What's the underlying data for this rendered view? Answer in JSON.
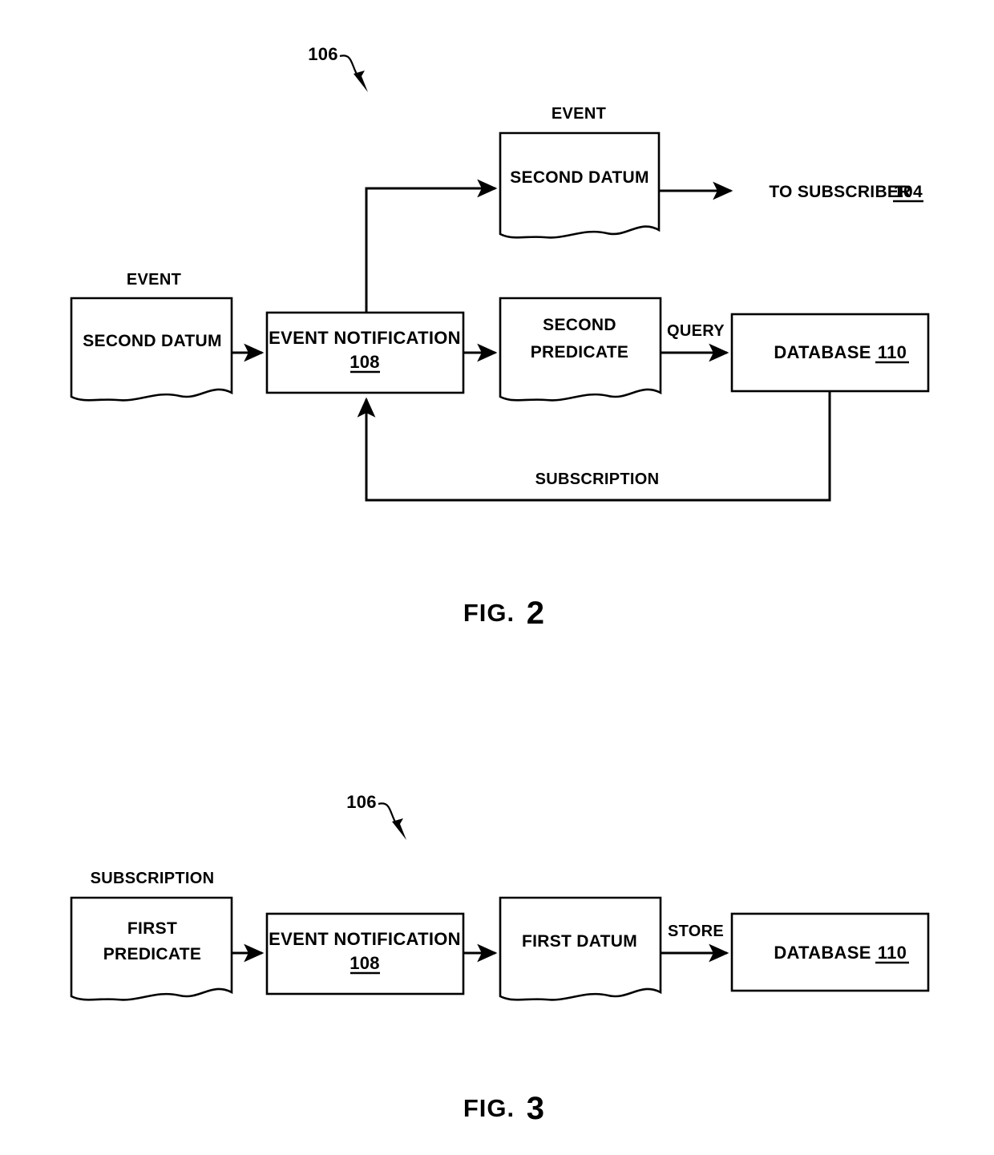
{
  "sheet": {
    "background": "#ffffff",
    "ink": "#000000"
  },
  "figures": [
    {
      "id": "fig2",
      "caption_prefix": "FIG.",
      "caption_number": "2",
      "reference_numeral": "106",
      "nodes": [
        {
          "name": "event-second-datum-top",
          "shape": "document",
          "caption_above": "EVENT",
          "lines": [
            "SECOND DATUM"
          ]
        },
        {
          "name": "event-second-datum-left",
          "shape": "document",
          "caption_above": "EVENT",
          "lines": [
            "SECOND DATUM"
          ]
        },
        {
          "name": "event-notification",
          "shape": "rectangle",
          "lines": [
            "EVENT NOTIFICATION"
          ],
          "numeral": "108"
        },
        {
          "name": "second-predicate",
          "shape": "document",
          "lines": [
            "SECOND",
            "PREDICATE"
          ]
        },
        {
          "name": "database",
          "shape": "rectangle",
          "lines": [
            "DATABASE"
          ],
          "numeral": "110"
        }
      ],
      "edge_labels": {
        "query": "QUERY",
        "subscription": "SUBSCRIPTION"
      },
      "terminal_text": {
        "prefix": "TO SUBSCRIBER",
        "numeral": "104"
      }
    },
    {
      "id": "fig3",
      "caption_prefix": "FIG.",
      "caption_number": "3",
      "reference_numeral": "106",
      "nodes": [
        {
          "name": "subscription-first-predicate",
          "shape": "document",
          "caption_above": "SUBSCRIPTION",
          "lines": [
            "FIRST",
            "PREDICATE"
          ]
        },
        {
          "name": "event-notification",
          "shape": "rectangle",
          "lines": [
            "EVENT NOTIFICATION"
          ],
          "numeral": "108"
        },
        {
          "name": "first-datum",
          "shape": "document",
          "lines": [
            "FIRST DATUM"
          ]
        },
        {
          "name": "database",
          "shape": "rectangle",
          "lines": [
            "DATABASE"
          ],
          "numeral": "110"
        }
      ],
      "edge_labels": {
        "store": "STORE"
      }
    }
  ]
}
